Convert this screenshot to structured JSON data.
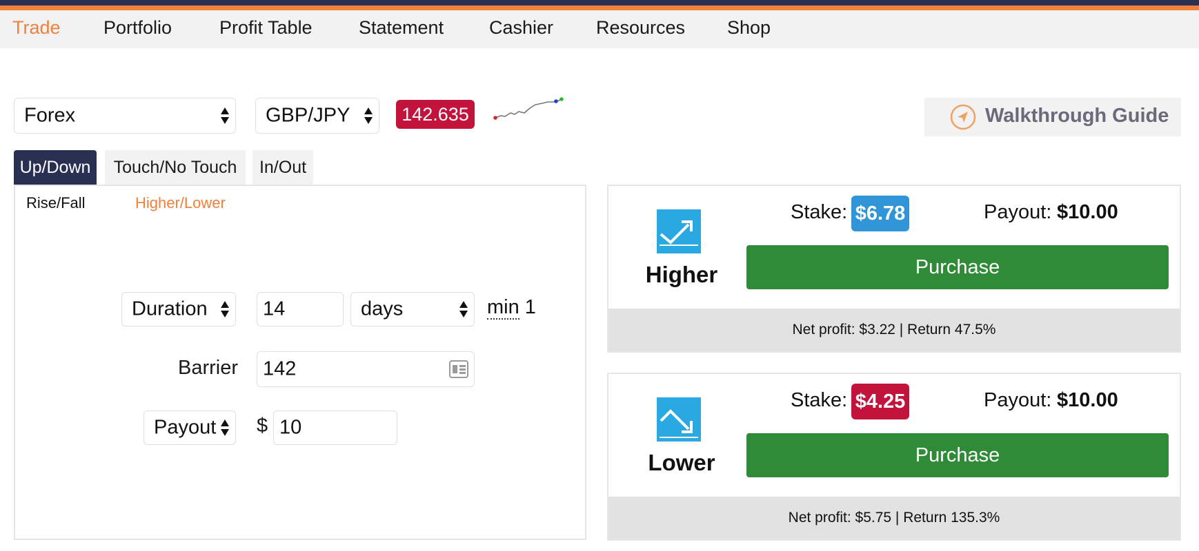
{
  "menu": {
    "items": [
      "Trade",
      "Portfolio",
      "Profit Table",
      "Statement",
      "Cashier",
      "Resources",
      "Shop"
    ],
    "active": "Trade"
  },
  "market": {
    "category": "Forex",
    "symbol": "GBP/JPY",
    "price": "142.635",
    "sparkline_colors": {
      "start": "#d9262a",
      "end": "#2fb82f",
      "marker": "#2440c8"
    }
  },
  "walkthrough": {
    "label": "Walkthrough Guide"
  },
  "tabs": {
    "items": [
      "Up/Down",
      "Touch/No Touch",
      "In/Out"
    ],
    "active": "Up/Down"
  },
  "subtabs": {
    "items": [
      "Rise/Fall",
      "Higher/Lower"
    ],
    "active": "Higher/Lower"
  },
  "form": {
    "duration_type": "Duration",
    "duration_value": "14",
    "duration_unit": "days",
    "min_word": "min",
    "min_value": "1",
    "barrier_label": "Barrier",
    "barrier_value": "142",
    "payout_type": "Payout",
    "currency_symbol": "$",
    "payout_value": "10"
  },
  "contracts": [
    {
      "name": "Higher",
      "stake_label": "Stake:",
      "stake": "$6.78",
      "stake_color": "#2f95d6",
      "payout_label": "Payout:",
      "payout": "$10.00",
      "button": "Purchase",
      "footer": "Net profit: $3.22 | Return 47.5%"
    },
    {
      "name": "Lower",
      "stake_label": "Stake:",
      "stake": "$4.25",
      "stake_color": "#c2133d",
      "payout_label": "Payout:",
      "payout": "$10.00",
      "button": "Purchase",
      "footer": "Net profit: $5.75 | Return 135.3%"
    }
  ],
  "colors": {
    "accent": "#f0803c",
    "navy": "#2a3052",
    "purchase": "#2f8b37",
    "icon_blue": "#2aa8e2"
  }
}
